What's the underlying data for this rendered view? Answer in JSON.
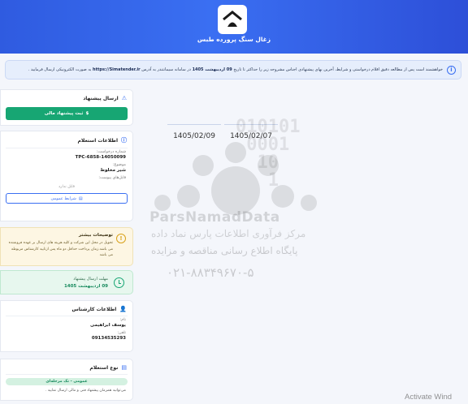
{
  "header": {
    "title": "زغال سنگ پرورده طبس"
  },
  "notice": {
    "text_before": "خواهشمند است پس از مطالعه دقیق اقلام درخواستی و شرایط، آخرین بهای پیشنهادی اجناس مشروحه زیر را حداکثر تا تاریخ",
    "deadline": "09 اردیبهشت 1405",
    "text_middle": "در سامانه سیمانتندر به آدرس",
    "url": "https://Simatender.ir",
    "text_after": "به صورت الکترونیکی ارسال فرمایید ."
  },
  "send_offer": {
    "title": "ارسال پیشنهاد",
    "button_label": "ثبت پیشنهاد مالی"
  },
  "inquiry_info": {
    "title": "اطلاعات استعلام",
    "request_number_label": "شماره درخواست:",
    "request_number": "TPC-6858-14050099",
    "subject_label": "موضوع:",
    "subject": "شیر مخلوط",
    "attachments_label": "فایل‌های پیوست:",
    "attachments_empty": "فایل ندارد",
    "general_terms_button": "شرایط عمومی"
  },
  "more_info": {
    "title": "توضیحات بیشتر",
    "text": "تحویل در محل این شرکت و کلیه هزینه های ارسال بر عهده فروشنده می باشد.زمان پرداخت حداقل دو ماه پس ازتایید کارشناس مربوطه می باشد"
  },
  "deadline_card": {
    "label": "مهلت ارسال پیشنهاد",
    "value": "09 اردیبهشت 1405"
  },
  "expert_info": {
    "title": "اطلاعات کارشناس",
    "name_label": "نام:",
    "name": "یوسف ابراهیمی",
    "phone_label": "تلفن:",
    "phone": "09134535293"
  },
  "inquiry_type": {
    "title": "نوع استعلام",
    "value": "عمومی - تک مرحله‌ای",
    "note": "می‌توانید همزمان پیشنهاد فنی و مالی ارسال نمایید ."
  },
  "dates": [
    "1405/02/07",
    "1405/02/09"
  ],
  "watermark": {
    "brand": "ParsNamadData",
    "line1": "مرکز فرآوری اطلاعات پارس نماد داده",
    "line2": "پایگاه اطلاع رسانی مناقصه و مزایده",
    "phone": "۰۲۱-۸۸۳۴۹۶۷۰-۵"
  },
  "os_overlay": {
    "text": "Activate Wind"
  },
  "colors": {
    "header_blue": "#3a6ff2",
    "green": "#17a673",
    "warn_bg": "#fdf6e3"
  }
}
